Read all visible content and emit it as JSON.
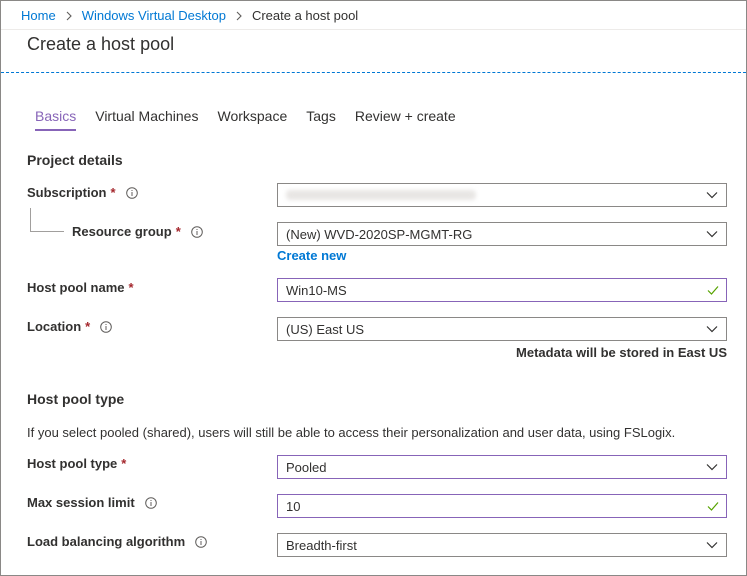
{
  "breadcrumb": {
    "home": "Home",
    "parent": "Windows Virtual Desktop",
    "current": "Create a host pool"
  },
  "page": {
    "title": "Create a host pool"
  },
  "tabs": [
    {
      "label": "Basics",
      "active": true
    },
    {
      "label": "Virtual Machines",
      "active": false
    },
    {
      "label": "Workspace",
      "active": false
    },
    {
      "label": "Tags",
      "active": false
    },
    {
      "label": "Review + create",
      "active": false
    }
  ],
  "project_details": {
    "heading": "Project details",
    "subscription": {
      "label": "Subscription",
      "required_mark": "*",
      "value": ""
    },
    "resource_group": {
      "label": "Resource group",
      "required_mark": "*",
      "value": "(New) WVD-2020SP-MGMT-RG",
      "create_new": "Create new"
    }
  },
  "host_pool_name": {
    "label": "Host pool name",
    "required_mark": "*",
    "value": "Win10-MS"
  },
  "location": {
    "label": "Location",
    "required_mark": "*",
    "value": "(US) East US",
    "note": "Metadata will be stored in East US"
  },
  "host_pool_type_section": {
    "heading": "Host pool type",
    "description": "If you select pooled (shared), users will still be able to access their personalization and user data, using FSLogix.",
    "type": {
      "label": "Host pool type",
      "required_mark": "*",
      "value": "Pooled"
    },
    "max_session": {
      "label": "Max session limit",
      "value": "10"
    },
    "load_balancing": {
      "label": "Load balancing algorithm",
      "value": "Breadth-first"
    }
  },
  "colors": {
    "accent_link": "#0078d4",
    "tab_active": "#8764b8",
    "required": "#a4262c",
    "valid_check": "#57a300"
  },
  "icons": {
    "breadcrumb_separator": "chevron-right-icon",
    "info": "info-icon",
    "dropdown": "chevron-down-icon",
    "valid": "checkmark-icon"
  }
}
